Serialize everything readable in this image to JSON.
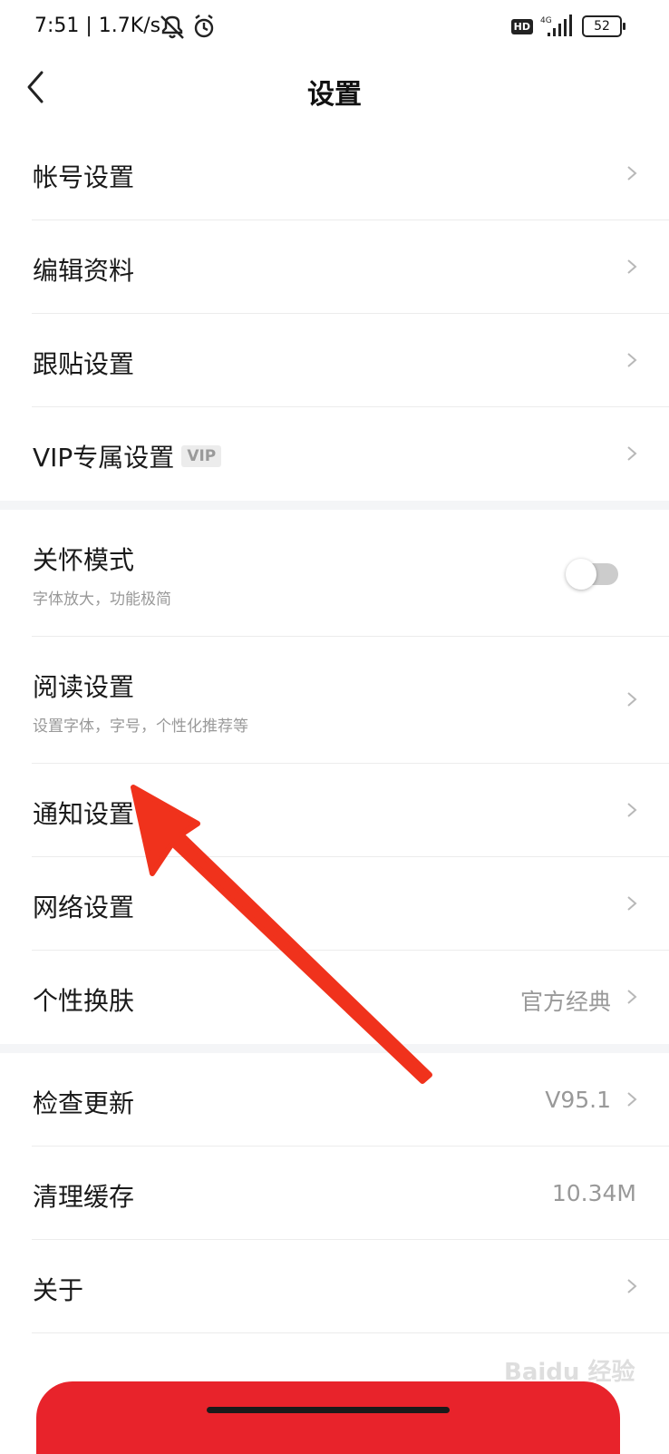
{
  "status_bar": {
    "time": "7:51 | 1.7K/s",
    "hd": "HD",
    "network": "4G",
    "battery": "52"
  },
  "nav": {
    "title": "设置"
  },
  "groups": {
    "account": {
      "account_settings": "帐号设置",
      "edit_profile": "编辑资料",
      "follow_post_settings": "跟贴设置",
      "vip_settings": "VIP专属设置",
      "vip_badge": "VIP"
    },
    "general": {
      "care_mode": {
        "label": "关怀模式",
        "sub": "字体放大，功能极简",
        "enabled": false
      },
      "reading": {
        "label": "阅读设置",
        "sub": "设置字体，字号，个性化推荐等"
      },
      "notification": "通知设置",
      "network": "网络设置",
      "skin": {
        "label": "个性换肤",
        "value": "官方经典"
      }
    },
    "system": {
      "check_update": {
        "label": "检查更新",
        "value": "V95.1"
      },
      "clear_cache": {
        "label": "清理缓存",
        "value": "10.34M"
      },
      "about": "关于"
    }
  },
  "watermark": "Baidu 经验",
  "colors": {
    "accent_red": "#e8232b",
    "arrow_red": "#f0321c",
    "toggle_off": "#cccccc"
  }
}
